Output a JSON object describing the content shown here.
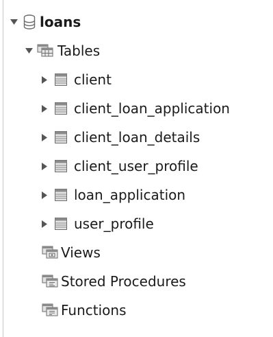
{
  "database": {
    "name": "loans",
    "icon": "database-icon",
    "expanded": true
  },
  "tables_folder": {
    "label": "Tables",
    "icon": "tables-folder-icon",
    "expanded": true
  },
  "tables": [
    {
      "name": "client",
      "icon": "table-icon",
      "expanded": false
    },
    {
      "name": "client_loan_application",
      "icon": "table-icon",
      "expanded": false
    },
    {
      "name": "client_loan_details",
      "icon": "table-icon",
      "expanded": false
    },
    {
      "name": "client_user_profile",
      "icon": "table-icon",
      "expanded": false
    },
    {
      "name": "loan_application",
      "icon": "table-icon",
      "expanded": false
    },
    {
      "name": "user_profile",
      "icon": "table-icon",
      "expanded": false
    }
  ],
  "other_folders": [
    {
      "label": "Views",
      "icon": "views-folder-icon"
    },
    {
      "label": "Stored Procedures",
      "icon": "stored-procedures-folder-icon"
    },
    {
      "label": "Functions",
      "icon": "functions-folder-icon"
    }
  ],
  "colors": {
    "text": "#1a1a1a",
    "toggle": "#555555",
    "icon_stroke": "#6b6b6b",
    "icon_fill": "#e2e2e2",
    "icon_header": "#8a8a8a",
    "border": "#c8c8c8"
  }
}
